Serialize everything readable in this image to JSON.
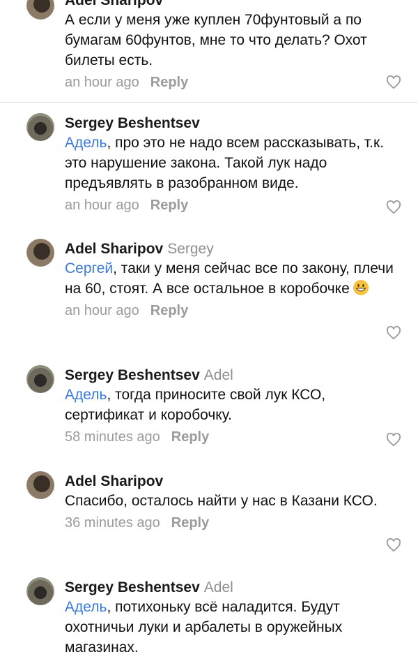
{
  "comments": [
    {
      "author": "Adel Sharipov",
      "reply_to": "",
      "mention": "",
      "text": "А если у меня уже куплен 70фунтовый а по бумагам 60фунтов, мне то что делать? Охот билеты есть.",
      "time": "an hour ago",
      "reply_label": "Reply"
    },
    {
      "author": "Sergey Beshentsev",
      "reply_to": "",
      "mention": "Адель",
      "text": ", про это не надо всем рассказывать, т.к. это нарушение закона. Такой лук надо предъявлять в разобранном виде.",
      "time": "an hour ago",
      "reply_label": "Reply"
    },
    {
      "author": "Adel Sharipov",
      "reply_to": "Sergey",
      "mention": "Сергей",
      "text": ", таки у меня сейчас все по закону, плечи   на 60, стоят. А все остальное в коробочке",
      "time": "an hour ago",
      "reply_label": "Reply"
    },
    {
      "author": "Sergey Beshentsev",
      "reply_to": "Adel",
      "mention": "Адель",
      "text": ", тогда приносите свой лук КСО, сертификат и коробочку.",
      "time": "58 minutes ago",
      "reply_label": "Reply"
    },
    {
      "author": "Adel Sharipov",
      "reply_to": "",
      "mention": "",
      "text": "Спасибо, осталось найти у нас в Казани КСО.",
      "time": "36 minutes ago",
      "reply_label": "Reply"
    },
    {
      "author": "Sergey Beshentsev",
      "reply_to": "Adel",
      "mention": "Адель",
      "text": ", потихоньку всё наладится. Будут охотничьи луки и арбалеты в оружейных магазинах.",
      "time": "",
      "reply_label": ""
    }
  ],
  "colors": {
    "link": "#3b7ad8",
    "meta": "#9a9a9f"
  },
  "icons": {
    "like": "heart-outline-icon",
    "emoji": "grinning-face-emoji"
  }
}
